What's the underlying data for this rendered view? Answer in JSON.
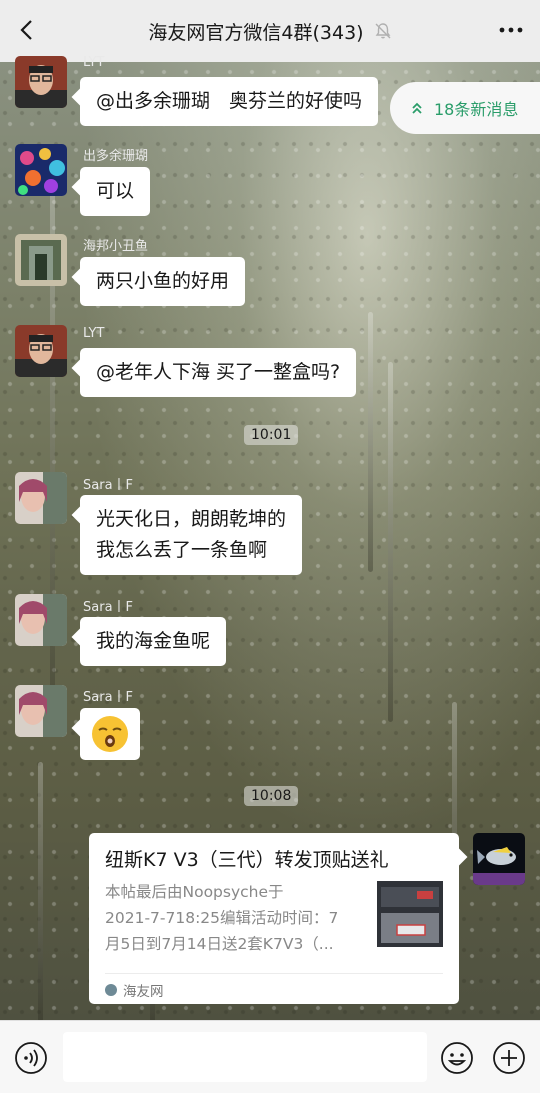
{
  "header": {
    "title": "海友网官方微信4群(343)",
    "back_icon": "chevron-left-icon",
    "mute_icon": "bell-muted-icon",
    "more_icon": "ellipsis-icon"
  },
  "new_messages_badge": "18条新消息",
  "messages": [
    {
      "sender": "LYT",
      "text": "@出多余珊瑚　奥芬兰的好使吗"
    },
    {
      "sender": "出多余珊瑚",
      "text": "可以"
    },
    {
      "sender": "海邦小丑鱼",
      "text": "两只小鱼的好用"
    },
    {
      "sender": "LYT",
      "text": "@老年人下海  买了一整盒吗?"
    },
    {
      "time": "10:01"
    },
    {
      "sender": "Sara丨F",
      "lines": [
        "光天化日，朗朗乾坤的",
        "我怎么丢了一条鱼啊"
      ]
    },
    {
      "sender": "Sara丨F",
      "text": "我的海金鱼呢"
    },
    {
      "sender": "Sara丨F",
      "sticker": "sleepy-face-emoji"
    },
    {
      "time": "10:08"
    }
  ],
  "card": {
    "title": "纽斯K7 V3（三代）转发顶贴送礼",
    "desc_lines": [
      "本帖最后由Noopsyche于",
      "2021-7-718:25编辑活动时间：7",
      "月5日到7月14日送2套K7V3（..."
    ],
    "source": "海友网"
  },
  "input_bar": {
    "voice_icon": "voice-icon",
    "emoji_icon": "emoji-icon",
    "plus_icon": "plus-circle-icon",
    "value": ""
  },
  "colors": {
    "header_bg": "#ededed",
    "accent_green": "#2a9d6a",
    "bubble_bg": "#ffffff"
  }
}
